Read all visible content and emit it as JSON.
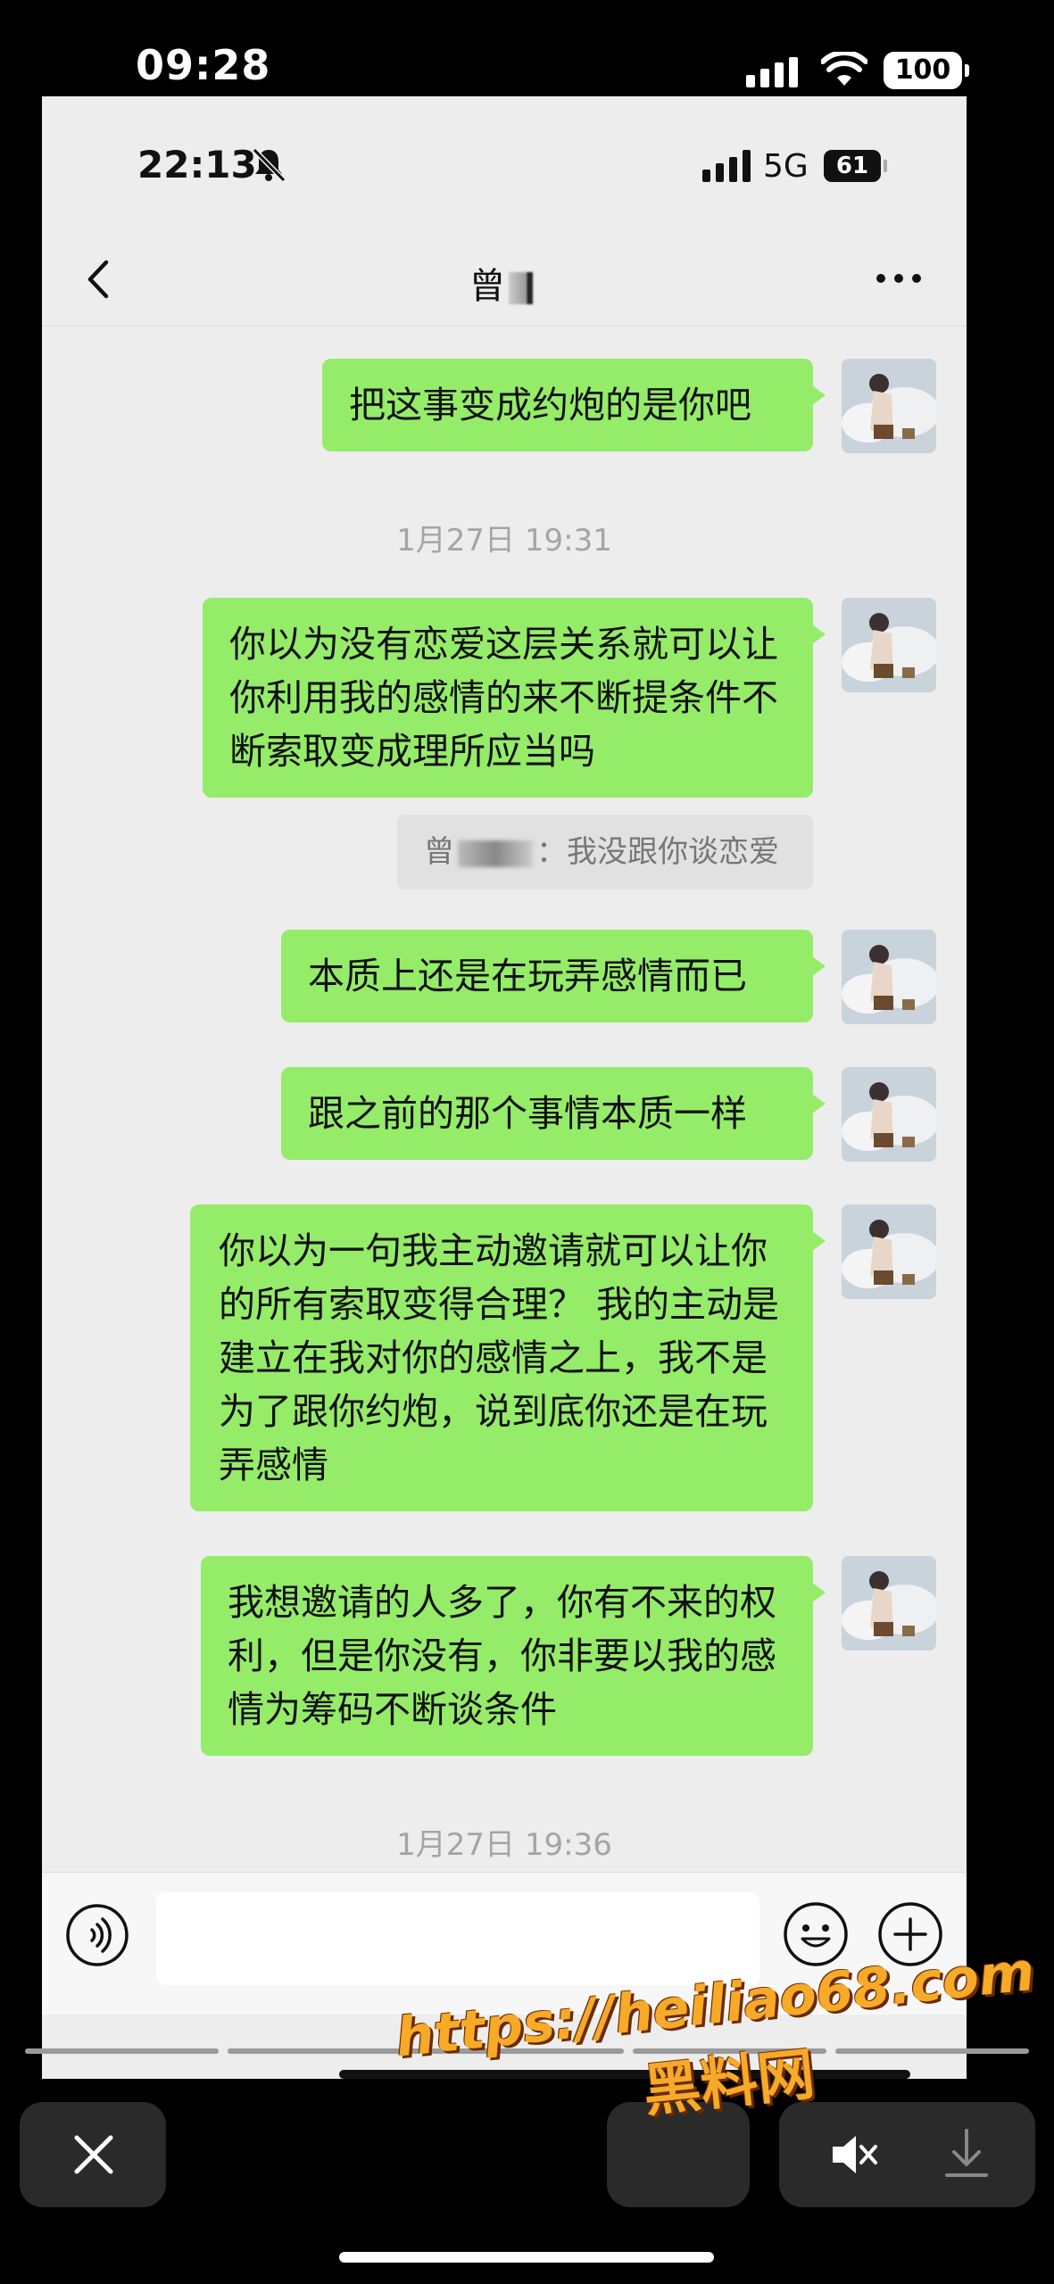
{
  "outer_status": {
    "time": "09:28",
    "battery": "100"
  },
  "inner_status": {
    "time": "22:13",
    "network": "5G",
    "battery": "61"
  },
  "header": {
    "title": "曾"
  },
  "messages": [
    {
      "text": "把这事变成约炮的是你吧"
    },
    {
      "text": "你以为没有恋爱这层关系就可以让你利用我的感情的来不断提条件不断索取变成理所应当吗"
    },
    {
      "text": "本质上还是在玩弄感情而已"
    },
    {
      "text": "跟之前的那个事情本质一样"
    },
    {
      "text": "你以为一句我主动邀请就可以让你的所有索取变得合理？ 我的主动是建立在我对你的感情之上，我不是为了跟你约炮，说到底你还是在玩弄感情"
    },
    {
      "text": "我想邀请的人多了，你有不来的权利，但是你没有，你非要以我的感情为筹码不断谈条件"
    }
  ],
  "timestamps": [
    "1月27日 19:31",
    "1月27日 19:36"
  ],
  "quote": {
    "sender": "曾",
    "separator": "：",
    "text": "我没跟你谈恋爱"
  },
  "watermark": {
    "url": "https://heiliao68.com",
    "name": "黑料网"
  },
  "colors": {
    "bubble_green": "#95ec69",
    "chat_bg": "#ededed",
    "watermark": "#f7a928"
  }
}
